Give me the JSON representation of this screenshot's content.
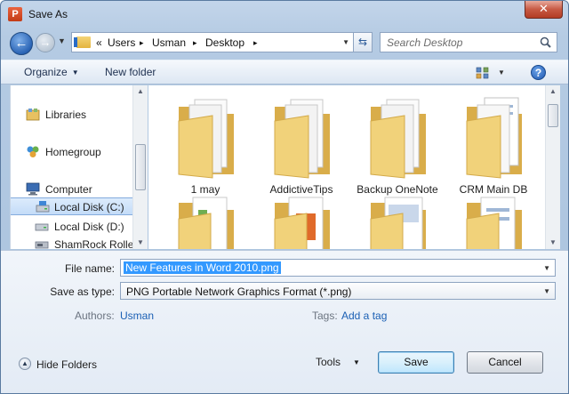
{
  "window": {
    "title": "Save As",
    "app_icon_letter": "P"
  },
  "address_bar": {
    "overflow": "«",
    "segments": [
      "Users",
      "Usman",
      "Desktop"
    ],
    "separator": "▸"
  },
  "search": {
    "placeholder": "Search Desktop"
  },
  "toolbar": {
    "organize_label": "Organize",
    "new_folder_label": "New folder"
  },
  "nav_pane": {
    "items": [
      {
        "label": "Libraries",
        "icon": "libraries-icon"
      },
      {
        "label": "Homegroup",
        "icon": "homegroup-icon"
      },
      {
        "label": "Computer",
        "icon": "computer-icon"
      },
      {
        "label": "Local Disk (C:)",
        "icon": "drive-c-icon",
        "selected": true
      },
      {
        "label": "Local Disk (D:)",
        "icon": "drive-d-icon"
      },
      {
        "label": "ShamRock Roller",
        "icon": "removable-drive-icon"
      }
    ]
  },
  "folders": [
    {
      "name": "1 may"
    },
    {
      "name": "AddictiveTips"
    },
    {
      "name": "Backup OneNote"
    },
    {
      "name": "CRM Main DB"
    }
  ],
  "form": {
    "file_name_label": "File name:",
    "file_name_value": "New Features in Word 2010.png",
    "save_type_label": "Save as type:",
    "save_type_value": "PNG Portable Network Graphics Format (*.png)",
    "authors_label": "Authors:",
    "authors_value": "Usman",
    "tags_label": "Tags:",
    "tags_value": "Add a tag"
  },
  "footer": {
    "hide_folders_label": "Hide Folders",
    "tools_label": "Tools",
    "save_label": "Save",
    "cancel_label": "Cancel"
  },
  "colors": {
    "accent": "#3399ff",
    "link": "#1a5fb4",
    "close": "#c75a44"
  }
}
